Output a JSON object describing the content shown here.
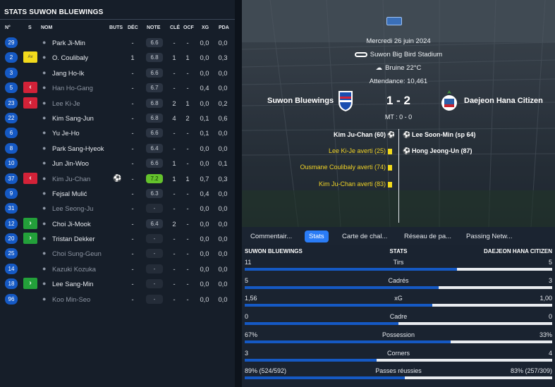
{
  "left": {
    "title": "STATS SUWON BLUEWINGS",
    "columns": {
      "no": "N°",
      "s": "S",
      "nom": "NOM",
      "buts": "BUTS",
      "dec": "DÉC",
      "note": "NOTE",
      "cle": "CLÉ",
      "ocf": "OCF",
      "xg": "XG",
      "pda": "PDA"
    },
    "players": [
      {
        "no": "29",
        "status": "",
        "name": "Park Ji-Min",
        "dim": false,
        "buts": "",
        "dec": "-",
        "note": "6.6",
        "cle": "-",
        "ocf": "-",
        "xg": "0,0",
        "pda": "0,0",
        "ball": false
      },
      {
        "no": "2",
        "status": "yellow",
        "status_text": "Av",
        "name": "O. Coulibaly",
        "dim": false,
        "buts": "",
        "dec": "1",
        "note": "6.8",
        "cle": "1",
        "ocf": "1",
        "xg": "0,0",
        "pda": "0,3",
        "ball": false
      },
      {
        "no": "3",
        "status": "",
        "name": "Jang Ho-Ik",
        "dim": false,
        "buts": "",
        "dec": "-",
        "note": "6.6",
        "cle": "-",
        "ocf": "-",
        "xg": "0,0",
        "pda": "0,0",
        "ball": false
      },
      {
        "no": "5",
        "status": "red",
        "name": "Han Ho-Gang",
        "dim": true,
        "buts": "",
        "dec": "-",
        "note": "6.7",
        "cle": "-",
        "ocf": "-",
        "xg": "0,4",
        "pda": "0,0",
        "ball": false
      },
      {
        "no": "23",
        "status": "red",
        "name": "Lee Ki-Je",
        "dim": true,
        "buts": "",
        "dec": "-",
        "note": "6.8",
        "cle": "2",
        "ocf": "1",
        "xg": "0,0",
        "pda": "0,2",
        "ball": false
      },
      {
        "no": "22",
        "status": "",
        "name": "Kim Sang-Jun",
        "dim": false,
        "buts": "",
        "dec": "-",
        "note": "6.8",
        "cle": "4",
        "ocf": "2",
        "xg": "0,1",
        "pda": "0,6",
        "ball": false
      },
      {
        "no": "6",
        "status": "",
        "name": "Yu Je-Ho",
        "dim": false,
        "buts": "",
        "dec": "-",
        "note": "6.6",
        "cle": "-",
        "ocf": "-",
        "xg": "0,1",
        "pda": "0,0",
        "ball": false
      },
      {
        "no": "8",
        "status": "",
        "name": "Park Sang-Hyeok",
        "dim": false,
        "buts": "",
        "dec": "-",
        "note": "6.4",
        "cle": "-",
        "ocf": "-",
        "xg": "0,0",
        "pda": "0,0",
        "ball": false
      },
      {
        "no": "10",
        "status": "",
        "name": "Jun Jin-Woo",
        "dim": false,
        "buts": "",
        "dec": "-",
        "note": "6.6",
        "cle": "1",
        "ocf": "-",
        "xg": "0,0",
        "pda": "0,1",
        "ball": false
      },
      {
        "no": "37",
        "status": "red",
        "name": "Kim Ju-Chan",
        "dim": true,
        "buts": "",
        "dec": "-",
        "note": "7.2",
        "cle": "1",
        "ocf": "1",
        "xg": "0,7",
        "pda": "0,3",
        "ball": true,
        "best": true
      },
      {
        "no": "9",
        "status": "",
        "name": "Fejsal Mulić",
        "dim": false,
        "buts": "",
        "dec": "-",
        "note": "6.3",
        "cle": "-",
        "ocf": "-",
        "xg": "0,4",
        "pda": "0,0",
        "ball": false
      },
      {
        "no": "31",
        "status": "",
        "name": "Lee Seong-Ju",
        "dim": true,
        "buts": "",
        "dec": "-",
        "note": "-",
        "cle": "-",
        "ocf": "-",
        "xg": "0,0",
        "pda": "0,0",
        "ball": false,
        "empty": true
      },
      {
        "no": "12",
        "status": "green",
        "name": "Choi Ji-Mook",
        "dim": false,
        "buts": "",
        "dec": "-",
        "note": "6.4",
        "cle": "2",
        "ocf": "-",
        "xg": "0,0",
        "pda": "0,0",
        "ball": false
      },
      {
        "no": "20",
        "status": "green",
        "name": "Tristan Dekker",
        "dim": false,
        "buts": "",
        "dec": "-",
        "note": "-",
        "cle": "-",
        "ocf": "-",
        "xg": "0,0",
        "pda": "0,0",
        "ball": false,
        "empty": true
      },
      {
        "no": "25",
        "status": "",
        "name": "Choi Sung-Geun",
        "dim": true,
        "buts": "",
        "dec": "-",
        "note": "-",
        "cle": "-",
        "ocf": "-",
        "xg": "0,0",
        "pda": "0,0",
        "ball": false,
        "empty": true
      },
      {
        "no": "14",
        "status": "",
        "name": "Kazuki Kozuka",
        "dim": true,
        "buts": "",
        "dec": "-",
        "note": "-",
        "cle": "-",
        "ocf": "-",
        "xg": "0,0",
        "pda": "0,0",
        "ball": false,
        "empty": true
      },
      {
        "no": "18",
        "status": "green",
        "name": "Lee Sang-Min",
        "dim": false,
        "buts": "",
        "dec": "-",
        "note": "-",
        "cle": "-",
        "ocf": "-",
        "xg": "0,0",
        "pda": "0,0",
        "ball": false,
        "empty": true
      },
      {
        "no": "96",
        "status": "",
        "name": "Koo Min-Seo",
        "dim": true,
        "buts": "",
        "dec": "-",
        "note": "-",
        "cle": "-",
        "ocf": "-",
        "xg": "0,0",
        "pda": "0,0",
        "ball": false,
        "empty": true
      }
    ]
  },
  "match": {
    "date": "Mercredi 26 juin 2024",
    "stadium": "Suwon Big Bird Stadium",
    "weather": "Bruine 22°C",
    "attendance": "Attendance: 10,461",
    "home": "Suwon Bluewings",
    "away": "Daejeon Hana Citizen",
    "score": "1 - 2",
    "halftime": "MT : 0 - 0",
    "home_events": [
      {
        "text": "Kim Ju-Chan (60)",
        "type": "goal"
      },
      {
        "text": "Lee Ki-Je averti (25)",
        "type": "card"
      },
      {
        "text": "Ousmane Coulibaly averti (74)",
        "type": "card"
      },
      {
        "text": "Kim Ju-Chan averti (83)",
        "type": "card"
      }
    ],
    "away_events": [
      {
        "text": "Lee Soon-Min (sp 64)",
        "type": "goal"
      },
      {
        "text": "Hong Jeong-Un (87)",
        "type": "goal"
      }
    ]
  },
  "tabs": [
    {
      "label": "Commentair...",
      "active": false
    },
    {
      "label": "Stats",
      "active": true
    },
    {
      "label": "Carte de chal...",
      "active": false
    },
    {
      "label": "Réseau de pa...",
      "active": false
    },
    {
      "label": "Passing Netw...",
      "active": false
    }
  ],
  "stats": {
    "home_team": "SUWON BLUEWINGS",
    "label": "STATS",
    "away_team": "DAEJEON HANA CITIZEN",
    "rows": [
      {
        "name": "Tirs",
        "home": "11",
        "away": "5",
        "share": 0.69
      },
      {
        "name": "Cadrés",
        "home": "5",
        "away": "3",
        "share": 0.63
      },
      {
        "name": "xG",
        "home": "1,56",
        "away": "1,00",
        "share": 0.61
      },
      {
        "name": "Cadre",
        "home": "0",
        "away": "0",
        "share": 0.5
      },
      {
        "name": "Possession",
        "home": "67%",
        "away": "33%",
        "share": 0.67
      },
      {
        "name": "Corners",
        "home": "3",
        "away": "4",
        "share": 0.43
      },
      {
        "name": "Passes réussies",
        "home": "89% (524/592)",
        "away": "83% (257/309)",
        "share": 0.52
      }
    ]
  }
}
